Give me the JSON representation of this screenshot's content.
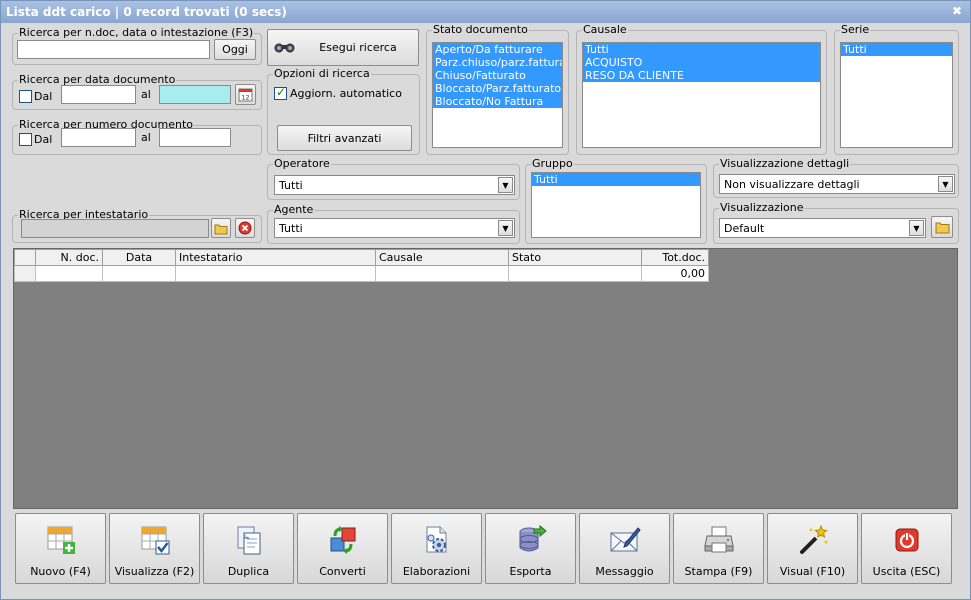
{
  "window": {
    "title": "Lista ddt carico | 0 record trovati (0 secs)"
  },
  "search_text": {
    "legend": "Ricerca per n.doc, data o intestazione (F3)",
    "value": "",
    "button": "Oggi"
  },
  "search_date": {
    "legend": "Ricerca per data documento",
    "from_label": "Dal",
    "to_label": "al",
    "from_value": "",
    "to_value": ""
  },
  "search_number": {
    "legend": "Ricerca per numero documento",
    "from_label": "Dal",
    "to_label": "al",
    "from_value": "",
    "to_value": ""
  },
  "search_holder": {
    "legend": "Ricerca per intestatario",
    "value": ""
  },
  "run_search": {
    "label": "Esegui ricerca"
  },
  "search_options": {
    "legend": "Opzioni di ricerca",
    "auto_update_label": "Aggiorn. automatico",
    "auto_update_checked": true,
    "advanced_filters": "Filtri avanzati"
  },
  "doc_state": {
    "legend": "Stato documento",
    "items": [
      "Aperto/Da fatturare",
      "Parz.chiuso/parz.fatturato",
      "Chiuso/Fatturato",
      "Bloccato/Parz.fatturato",
      "Bloccato/No Fattura"
    ]
  },
  "causale": {
    "legend": "Causale",
    "items": [
      "Tutti",
      "ACQUISTO",
      "RESO DA CLIENTE"
    ]
  },
  "serie": {
    "legend": "Serie",
    "items": [
      "Tutti"
    ]
  },
  "operatore": {
    "legend": "Operatore",
    "value": "Tutti"
  },
  "agente": {
    "legend": "Agente",
    "value": "Tutti"
  },
  "gruppo": {
    "legend": "Gruppo",
    "items": [
      "Tutti"
    ]
  },
  "details_view": {
    "legend": "Visualizzazione dettagli",
    "value": "Non visualizzare dettagli"
  },
  "view": {
    "legend": "Visualizzazione",
    "value": "Default"
  },
  "grid": {
    "columns": [
      "N. doc.",
      "Data",
      "Intestatario",
      "Causale",
      "Stato",
      "Tot.doc."
    ],
    "total": "0,00"
  },
  "toolbar": [
    {
      "label": "Nuovo (F4)",
      "icon": "new-grid-icon"
    },
    {
      "label": "Visualizza (F2)",
      "icon": "view-grid-icon"
    },
    {
      "label": "Duplica",
      "icon": "duplicate-icon"
    },
    {
      "label": "Converti",
      "icon": "convert-icon"
    },
    {
      "label": "Elaborazioni",
      "icon": "processing-icon"
    },
    {
      "label": "Esporta",
      "icon": "export-icon"
    },
    {
      "label": "Messaggio",
      "icon": "message-icon"
    },
    {
      "label": "Stampa (F9)",
      "icon": "print-icon"
    },
    {
      "label": "Visual (F10)",
      "icon": "magic-wand-icon"
    },
    {
      "label": "Uscita (ESC)",
      "icon": "exit-icon"
    }
  ]
}
